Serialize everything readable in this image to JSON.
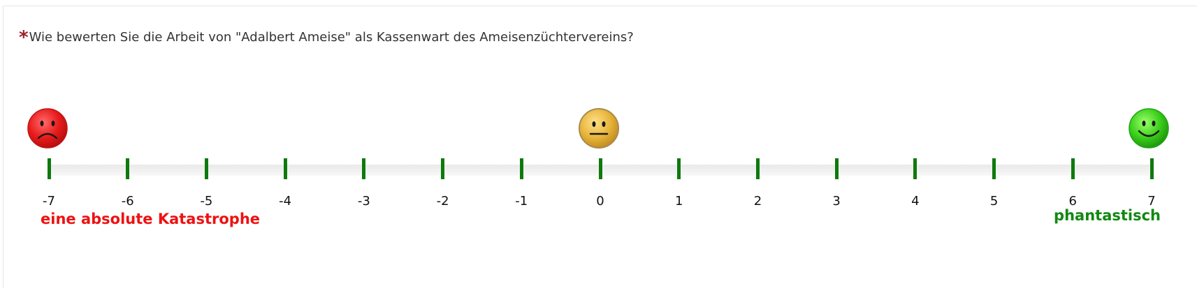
{
  "question": {
    "required_marker": "*",
    "text": "Wie bewerten Sie die Arbeit von \"Adalbert Ameise\"  als Kassenwart des Ameisenzüchtervereins?"
  },
  "scale": {
    "ticks": [
      "-7",
      "-6",
      "-5",
      "-4",
      "-3",
      "-2",
      "-1",
      "0",
      "1",
      "2",
      "3",
      "4",
      "5",
      "6",
      "7"
    ],
    "min_label": "eine absolute Katastrophe",
    "max_label": "phantastisch",
    "tick_color": "#0e7a0e",
    "min_label_color": "#ee1111",
    "max_label_color": "#118811"
  },
  "faces": {
    "sad": {
      "icon": "sad-face-icon",
      "color": "#e81c1c"
    },
    "neutral": {
      "icon": "neutral-face-icon",
      "color": "#e8b53c"
    },
    "happy": {
      "icon": "happy-face-icon",
      "color": "#3ccf1c"
    }
  }
}
